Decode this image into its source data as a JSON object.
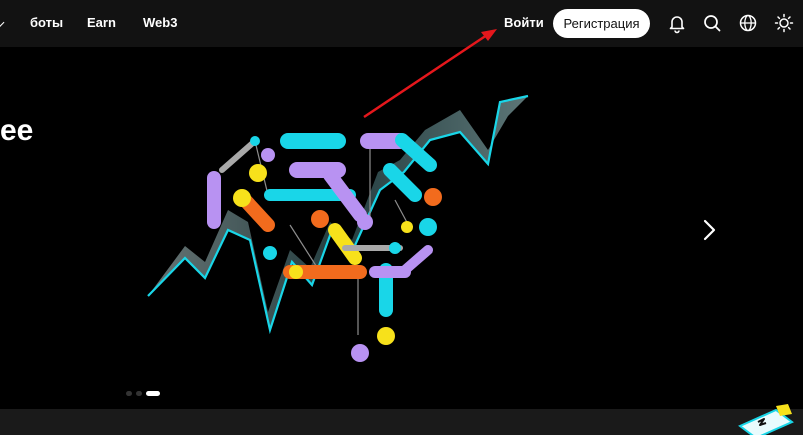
{
  "nav": {
    "items": [
      {
        "label": "боты"
      },
      {
        "label": "Earn"
      },
      {
        "label": "Web3"
      }
    ],
    "login_label": "Войти",
    "signup_label": "Регистрация",
    "icons": [
      "bell-icon",
      "search-icon",
      "globe-icon",
      "sun-icon"
    ]
  },
  "hero": {
    "title": "ee",
    "slides": 3,
    "active_slide": 3,
    "annotation_arrow_color": "#e5171c"
  },
  "colors": {
    "background": "#000000",
    "topbar": "#121212",
    "accent_cyan": "#19d6e8",
    "accent_purple": "#b892f2",
    "accent_yellow": "#f7e11b",
    "accent_orange": "#f26b1d"
  }
}
